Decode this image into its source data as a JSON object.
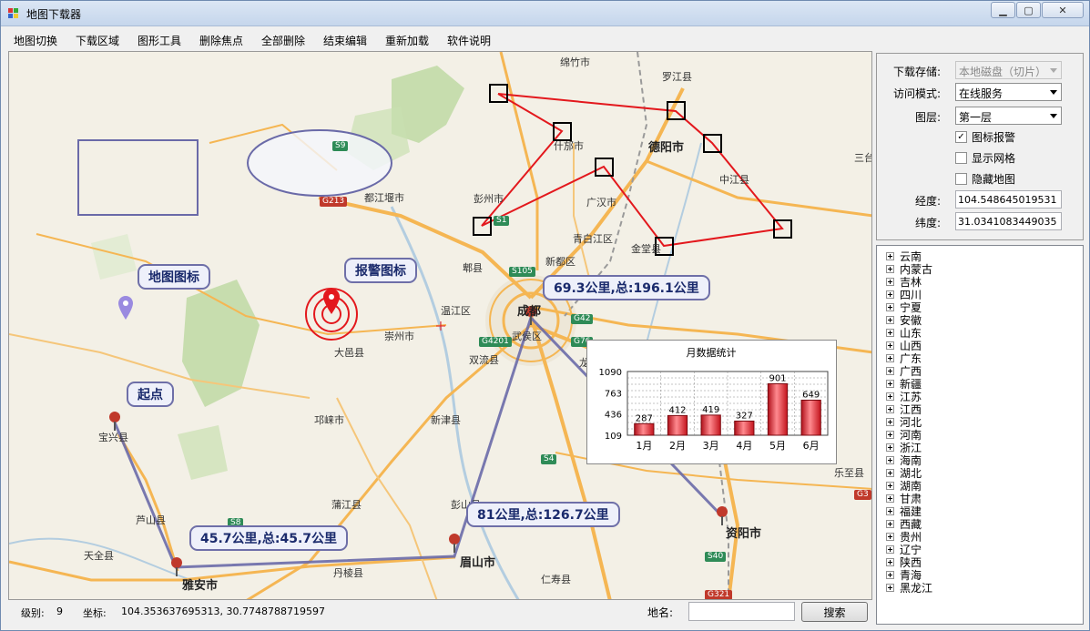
{
  "window": {
    "title": "地图下载器",
    "controls": [
      "minimize",
      "maximize",
      "close"
    ]
  },
  "menu": [
    "地图切换",
    "下载区域",
    "图形工具",
    "删除焦点",
    "全部删除",
    "结束编辑",
    "重新加载",
    "软件说明"
  ],
  "map": {
    "callouts": {
      "map_icon": "地图图标",
      "alarm_icon": "报警图标",
      "start": "起点",
      "seg1": "45.7公里,总:45.7公里",
      "seg2": "81公里,总:126.7公里",
      "seg3": "69.3公里,总:196.1公里"
    },
    "places": {
      "mianzhu": "绵竹市",
      "luojiang": "罗江县",
      "shifang": "什邡市",
      "deyang": "德阳市",
      "zhongjiang": "中江县",
      "sanhe": "三台",
      "dujiangyan": "都江堰市",
      "pengzhou": "彭州市",
      "guanghan": "广汉市",
      "qingbaijiang": "青白江区",
      "jintang": "金堂县",
      "xindu": "新都区",
      "pixian": "郫县",
      "wenjiang": "温江区",
      "chengdu": "成都",
      "wuhou": "武侯区",
      "chongzhou": "崇州市",
      "dayi": "大邑县",
      "shuangliu": "双流县",
      "longquan": "龙",
      "qionglai": "邛崃市",
      "xinjin": "新津县",
      "pujiang": "蒲江县",
      "pengshan": "彭山县",
      "meishan": "眉山市",
      "renshou": "仁寿县",
      "danleng": "丹棱县",
      "yaan": "雅安市",
      "baoxing": "宝兴县",
      "lushan": "芦山县",
      "tianquan": "天全县",
      "ziyang": "资阳市",
      "lezhi": "乐至县"
    },
    "shields": {
      "s9": "S9",
      "g213": "G213",
      "s1": "S1",
      "s105": "S105",
      "g42": "G42",
      "g4201": "G4201",
      "g76": "G76",
      "s4": "S4",
      "s8": "S8",
      "s40": "S40",
      "g321": "G321",
      "g3": "G3"
    },
    "colors": {
      "route": "#e3181d",
      "measure": "#6a6aa8",
      "water": "#b3cde0",
      "green": "#bcd8a0",
      "road": "#f5b653"
    }
  },
  "chart_data": {
    "type": "bar",
    "title": "月数据统计",
    "categories": [
      "1月",
      "2月",
      "3月",
      "4月",
      "5月",
      "6月"
    ],
    "values": [
      287,
      412,
      419,
      327,
      901,
      649
    ],
    "ylim": [
      109,
      1090
    ],
    "yticks": [
      "1090",
      "763",
      "436",
      "109"
    ],
    "grid": true,
    "bar_color": "#e8202a"
  },
  "status": {
    "level_label": "级别:",
    "level_value": "9",
    "coord_label": "坐标:",
    "coord_value": "104.353637695313, 30.7748788719597",
    "place_label": "地名:",
    "search_value": "",
    "search_button": "搜索"
  },
  "panel": {
    "storage_label": "下载存储:",
    "storage_value": "本地磁盘（切片）",
    "access_label": "访问模式:",
    "access_value": "在线服务",
    "layer_label": "图层:",
    "layer_value": "第一层",
    "chk_alarm": "图标报警",
    "chk_alarm_checked": true,
    "chk_grid": "显示网格",
    "chk_grid_checked": false,
    "chk_hide": "隐藏地图",
    "chk_hide_checked": false,
    "lon_label": "经度:",
    "lon_value": "104.548645019531",
    "lat_label": "纬度:",
    "lat_value": "31.0341083449035"
  },
  "provinces": [
    "云南",
    "内蒙古",
    "吉林",
    "四川",
    "宁夏",
    "安徽",
    "山东",
    "山西",
    "广东",
    "广西",
    "新疆",
    "江苏",
    "江西",
    "河北",
    "河南",
    "浙江",
    "海南",
    "湖北",
    "湖南",
    "甘肃",
    "福建",
    "西藏",
    "贵州",
    "辽宁",
    "陕西",
    "青海",
    "黑龙江"
  ]
}
